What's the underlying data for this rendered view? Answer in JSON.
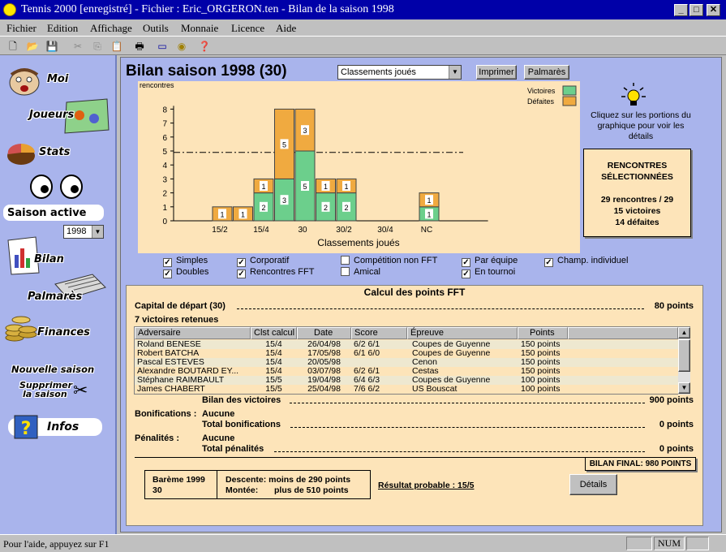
{
  "window": {
    "title": "Tennis 2000 [enregistré] - Fichier : Eric_ORGERON.ten - Bilan de la saison 1998"
  },
  "menu": [
    "Fichier",
    "Edition",
    "Affichage",
    "Outils",
    "Monnaie",
    "Licence",
    "Aide"
  ],
  "sidebar": {
    "moi": "Moi",
    "joueurs": "Joueurs",
    "stats": "Stats",
    "saison_active": "Saison active",
    "season_value": "1998",
    "bilan": "Bilan",
    "palmares": "Palmarès",
    "finances": "Finances",
    "nouvelle_saison": "Nouvelle saison",
    "supprimer_1": "Supprimer",
    "supprimer_2": "la saison",
    "infos": "Infos"
  },
  "header": {
    "title": "Bilan saison 1998 (30)",
    "dropdown_value": "Classements joués",
    "print_label": "Imprimer",
    "palmares_label": "Palmarès"
  },
  "hint": {
    "text": "Cliquez sur les portions du graphique pour voir les détails"
  },
  "selected_box": {
    "title_1": "RENCONTRES",
    "title_2": "SÉLECTIONNÉES",
    "line1": "29 rencontres / 29",
    "line2": "15 victoires",
    "line3": "14 défaites"
  },
  "chart_data": {
    "type": "bar",
    "ylabel": "rencontres",
    "xlabel": "Classements joués",
    "ylim": [
      0,
      8
    ],
    "yticks": [
      "0",
      "1",
      "2",
      "3",
      "4",
      "5",
      "6",
      "7",
      "8"
    ],
    "reference_line": 4.9,
    "xtick_labels": [
      "15/2",
      "15/4",
      "30",
      "30/2",
      "30/4",
      "NC"
    ],
    "bars": [
      {
        "slot": 0,
        "victoires": 0,
        "defaites": 1
      },
      {
        "slot": 1,
        "victoires": 0,
        "defaites": 1
      },
      {
        "slot": 2,
        "victoires": 2,
        "defaites": 1
      },
      {
        "slot": 3,
        "victoires": 3,
        "defaites": 5
      },
      {
        "slot": 4,
        "victoires": 5,
        "defaites": 3
      },
      {
        "slot": 5,
        "victoires": 2,
        "defaites": 1
      },
      {
        "slot": 6,
        "victoires": 2,
        "defaites": 1
      },
      {
        "slot": 10,
        "victoires": 1,
        "defaites": 1
      }
    ],
    "legend": [
      "Victoires",
      "Défaites"
    ],
    "colors": {
      "victoires": "#6ccf8c",
      "defaites": "#f0aa40"
    }
  },
  "filters": [
    {
      "label": "Simples",
      "checked": true
    },
    {
      "label": "Doubles",
      "checked": true
    },
    {
      "label": "Corporatif",
      "checked": true
    },
    {
      "label": "Rencontres FFT",
      "checked": true
    },
    {
      "label": "Compétition non FFT",
      "checked": false
    },
    {
      "label": "Amical",
      "checked": false
    },
    {
      "label": "Par équipe",
      "checked": true
    },
    {
      "label": "En tournoi",
      "checked": true
    },
    {
      "label": "Champ. individuel",
      "checked": true
    }
  ],
  "fft": {
    "title": "Calcul des points FFT",
    "capital_label": "Capital de départ (30)",
    "capital_value": "80 points",
    "victories_label": "7 victoires retenues",
    "columns": [
      "Adversaire",
      "Clst calcul",
      "Date",
      "Score",
      "Épreuve",
      "Points"
    ],
    "rows": [
      [
        "Roland BENESE",
        "15/4",
        "26/04/98",
        "6/2 6/1",
        "Coupes de Guyenne",
        "150 points"
      ],
      [
        "Robert BATCHA",
        "15/4",
        "17/05/98",
        "6/1 6/0",
        "Coupes de Guyenne",
        "150 points"
      ],
      [
        "Pascal ESTEVES",
        "15/4",
        "20/05/98",
        "",
        "Cenon",
        "150 points"
      ],
      [
        "Alexandre BOUTARD EY...",
        "15/4",
        "03/07/98",
        "6/2 6/1",
        "Cestas",
        "150 points"
      ],
      [
        "Stéphane RAIMBAULT",
        "15/5",
        "19/04/98",
        "6/4 6/3",
        "Coupes de Guyenne",
        "100 points"
      ],
      [
        "James CHABERT",
        "15/5",
        "25/04/98",
        "7/6 6/2",
        "US Bouscat",
        "100 points"
      ]
    ],
    "bilan_label": "Bilan des victoires",
    "bilan_value": "900 points",
    "bonif_label": "Bonifications :",
    "bonif_value": "Aucune",
    "total_bonif_label": "Total bonifications",
    "total_bonif_value": "0 points",
    "penal_label": "Pénalités :",
    "penal_value": "Aucune",
    "total_penal_label": "Total pénalités",
    "total_penal_value": "0 points",
    "final": "BILAN FINAL: 980 POINTS",
    "bareme_1": "Barème 1999",
    "bareme_2": "30",
    "descente": "Descente: moins de 290 points",
    "montee_label": "Montée:",
    "montee_value": "plus de 510 points",
    "result": "Résultat probable : 15/5",
    "details_label": "Détails"
  },
  "statusbar": {
    "text": "Pour l'aide, appuyez sur F1",
    "num": "NUM"
  }
}
